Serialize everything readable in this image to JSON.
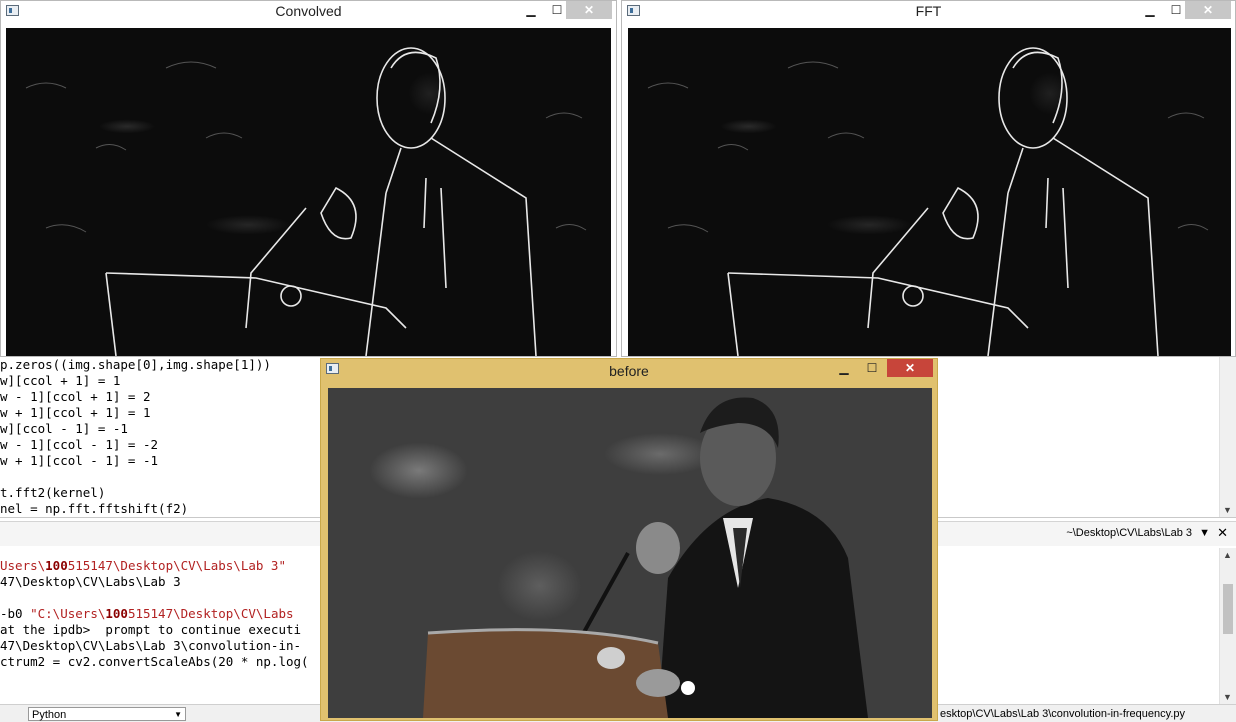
{
  "editor": {
    "lines": [
      "p.zeros((img.shape[0],img.shape[1]))",
      "w][ccol + 1] = 1",
      "w - 1][ccol + 1] = 2",
      "w + 1][ccol + 1] = 1",
      "w][ccol - 1] = -1",
      "w - 1][ccol - 1] = -2",
      "w + 1][ccol - 1] = -1",
      "",
      "t.fft2(kernel)",
      "nel = np.fft.fftshift(f2)"
    ]
  },
  "console_header": {
    "path": "~\\Desktop\\CV\\Labs\\Lab 3"
  },
  "console": {
    "line1_pre": "Users\\",
    "line1_bold": "100",
    "line1_post": "515147\\Desktop\\CV\\Labs\\Lab 3\"",
    "line2": "47\\Desktop\\CV\\Labs\\Lab 3",
    "line3_pre": "-b0 ",
    "line3_red_pre": "\"C:\\Users\\",
    "line3_red_bold": "100",
    "line3_red_post": "515147\\Desktop\\CV\\Labs",
    "line4": "at the ipdb>  prompt to continue executi",
    "line5": "47\\Desktop\\CV\\Labs\\Lab 3\\convolution-in-",
    "line6": "ctrum2 = cv2.convertScaleAbs(20 * np.log("
  },
  "statusbar": {
    "language": "Python",
    "path": "esktop\\CV\\Labs\\Lab 3\\convolution-in-frequency.py"
  },
  "windows": {
    "convolved": {
      "title": "Convolved",
      "min": "▁",
      "max": "☐",
      "close": "✕"
    },
    "fft": {
      "title": "FFT",
      "min": "▁",
      "max": "☐",
      "close": "✕"
    },
    "before": {
      "title": "before",
      "min": "▁",
      "max": "☐",
      "close": "✕"
    }
  },
  "colors": {
    "active_frame": "#e0c16f",
    "close_active": "#c7453a",
    "close_inactive": "#c7c7c7"
  }
}
